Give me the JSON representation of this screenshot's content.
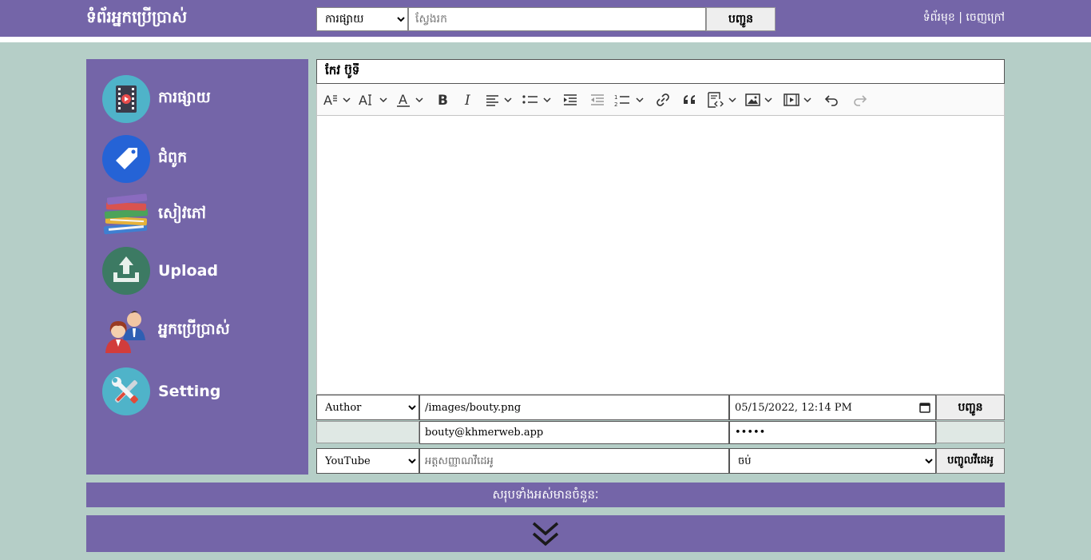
{
  "header": {
    "site_title": "ទំព័រអ្នកប្រើប្រាស់",
    "category_select": {
      "selected": "ការផ្សាយ"
    },
    "search": {
      "placeholder": "ស្វែងរក"
    },
    "search_button": "បញ្ជូន",
    "links": {
      "home": "ទំព័រមុខ",
      "separator": " | ",
      "logout": "ចេញក្រៅ"
    }
  },
  "sidebar": {
    "items": [
      {
        "label": "ការផ្សាយ",
        "icon": "video-film-icon"
      },
      {
        "label": "ជំពូក",
        "icon": "tag-icon"
      },
      {
        "label": "សៀវភៅ",
        "icon": "books-icon"
      },
      {
        "label": "Upload",
        "icon": "upload-icon"
      },
      {
        "label": "អ្នកប្រើប្រាស់",
        "icon": "users-icon"
      },
      {
        "label": "Setting",
        "icon": "tools-icon"
      }
    ]
  },
  "editor": {
    "title_value": "កែវ ប៊ូទី",
    "toolbar": [
      "font-family",
      "font-size",
      "font-color",
      "bold",
      "italic",
      "alignment",
      "bulleted-list",
      "indent",
      "outdent",
      "numbered-list",
      "link",
      "blockquote",
      "source-code",
      "insert-image",
      "insert-media",
      "undo",
      "redo"
    ]
  },
  "form": {
    "author_select": {
      "selected": "Author"
    },
    "thumbnail_path": "/images/bouty.png",
    "datetime_value": "05/15/2022, 12:14 PM",
    "submit_button": "បញ្ជូន",
    "email_value": "bouty@khmerweb.app",
    "password_mask": "•••••",
    "video_type_select": {
      "selected": "YouTube"
    },
    "video_id_input": {
      "placeholder": "អត្តសញ្ញាណវីដេអូ"
    },
    "video_status_select": {
      "selected": "ចប់"
    },
    "add_video_button": "បញ្ចូលវីដេអូ"
  },
  "footer": {
    "count_text": "សរុបទាំងអស់មានចំនួនៈ"
  },
  "colors": {
    "primary_purple": "#7465a8",
    "background_teal": "#b5cec7"
  }
}
